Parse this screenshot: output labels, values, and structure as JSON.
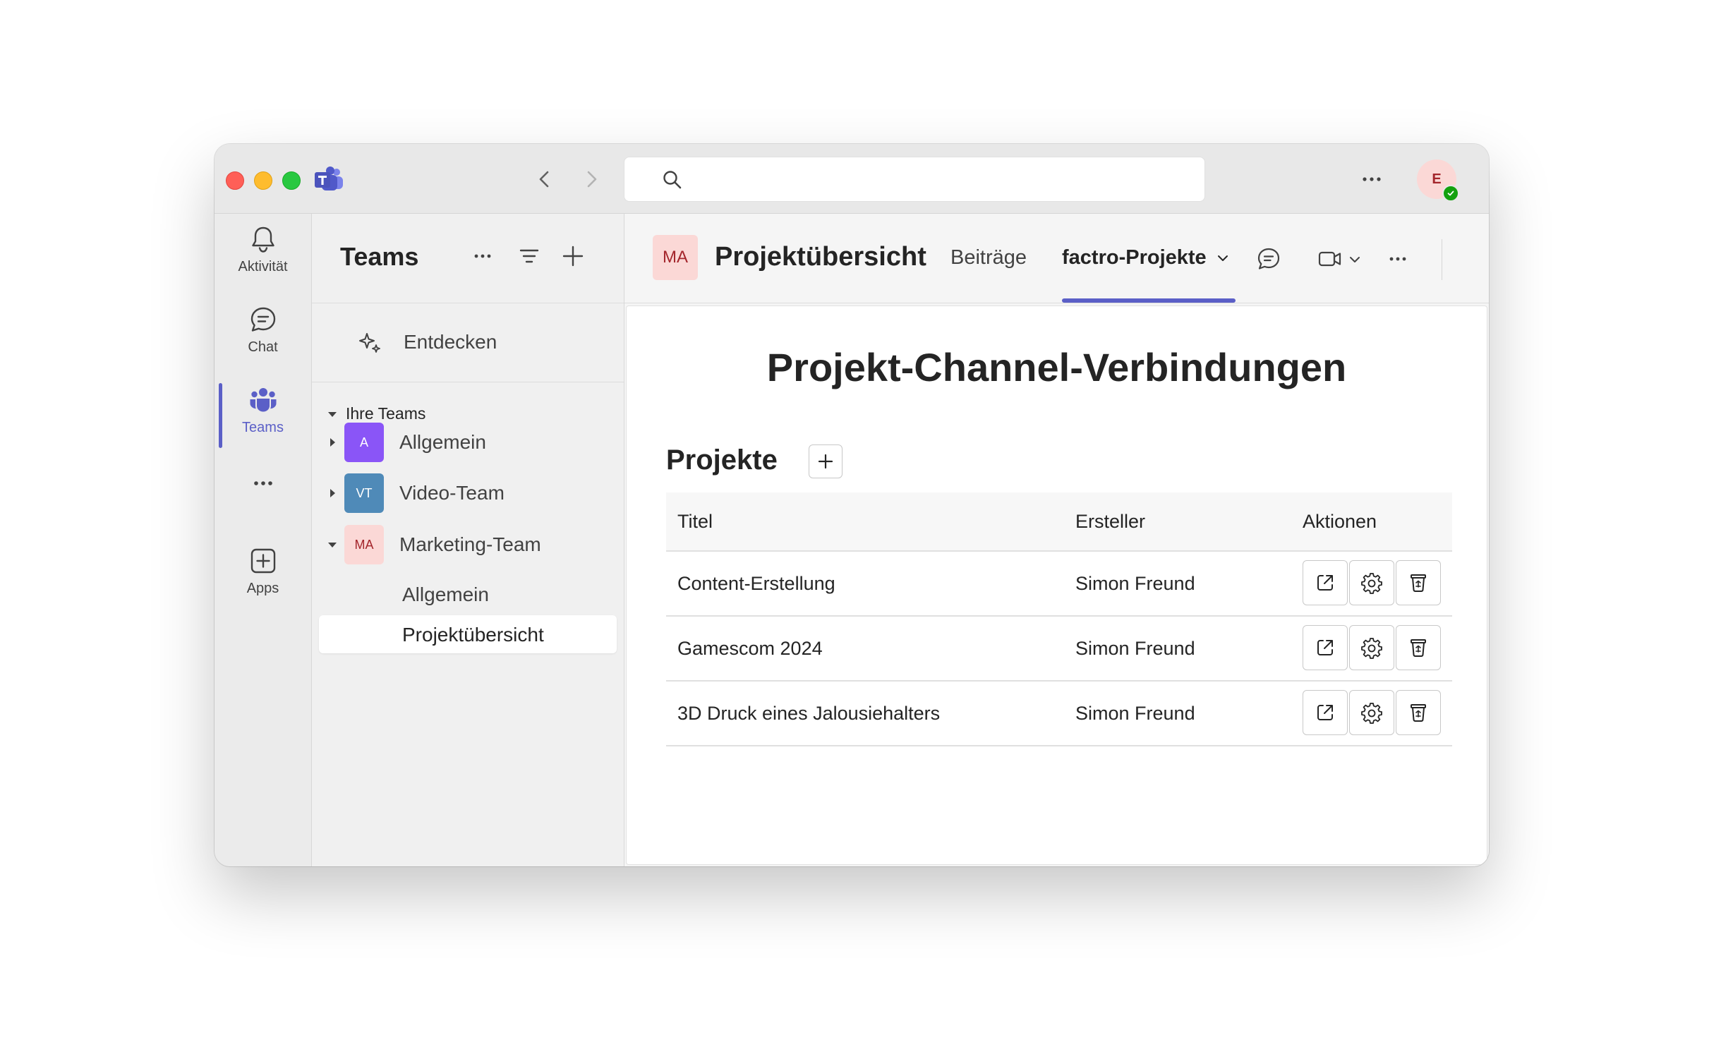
{
  "window": {
    "search": {
      "placeholder": ""
    },
    "user_avatar": {
      "initials": "E"
    }
  },
  "rail": {
    "items": [
      {
        "label": "Aktivität",
        "icon": "bell-icon"
      },
      {
        "label": "Chat",
        "icon": "chat-icon"
      },
      {
        "label": "Teams",
        "icon": "teams-icon",
        "active": true
      },
      {
        "label": "",
        "icon": "more-icon"
      },
      {
        "label": "Apps",
        "icon": "add-app-icon"
      }
    ]
  },
  "panel": {
    "title": "Teams",
    "discover_label": "Entdecken",
    "section_label": "Ihre Teams",
    "teams": [
      {
        "initials": "A",
        "name": "Allgemein",
        "color": "#8a55f7",
        "expanded": false
      },
      {
        "initials": "VT",
        "name": "Video-Team",
        "color": "#4f8ab8",
        "expanded": false
      },
      {
        "initials": "MA",
        "name": "Marketing-Team",
        "color": "#fbd8d6",
        "expanded": true
      }
    ],
    "channels": [
      {
        "name": "Allgemein",
        "selected": false
      },
      {
        "name": "Projektübersicht",
        "selected": true
      }
    ]
  },
  "main": {
    "channel_initials": "MA",
    "channel_title": "Projektübersicht",
    "tabs": [
      {
        "label": "Beiträge",
        "active": false
      },
      {
        "label": "factro-Projekte",
        "active": true
      }
    ],
    "accent_color": "#5b5fc7"
  },
  "content": {
    "title": "Projekt-Channel-Verbindungen",
    "section_title": "Projekte",
    "columns": [
      "Titel",
      "Ersteller",
      "Aktionen"
    ],
    "rows": [
      {
        "title": "Content-Erstellung",
        "creator": "Simon Freund"
      },
      {
        "title": "Gamescom 2024",
        "creator": "Simon Freund"
      },
      {
        "title": "3D Druck eines Jalousiehalters",
        "creator": "Simon Freund"
      }
    ],
    "row_actions": [
      "open-external-icon",
      "settings-icon",
      "delete-icon"
    ]
  }
}
